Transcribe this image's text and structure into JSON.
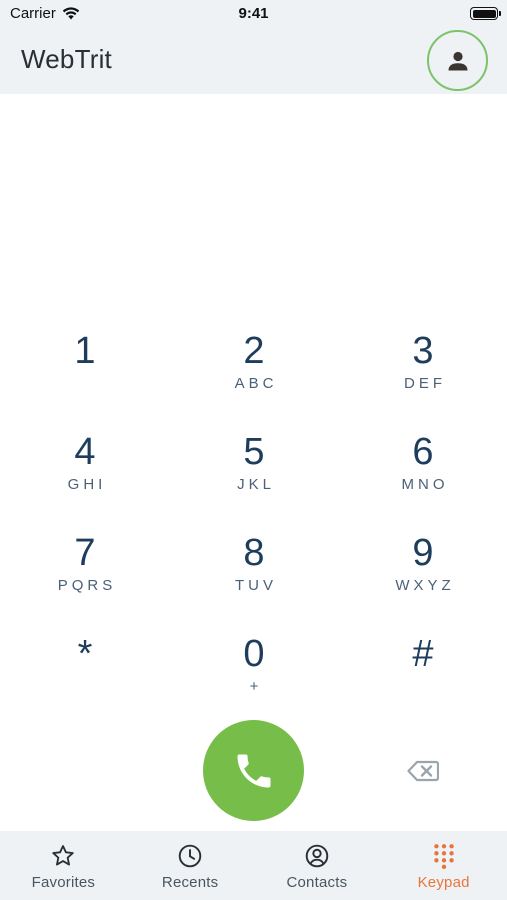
{
  "status_bar": {
    "carrier": "Carrier",
    "time": "9:41"
  },
  "header": {
    "title": "WebTrit"
  },
  "keypad": {
    "rows": [
      [
        {
          "digit": "1",
          "letters": ""
        },
        {
          "digit": "2",
          "letters": "ABC"
        },
        {
          "digit": "3",
          "letters": "DEF"
        }
      ],
      [
        {
          "digit": "4",
          "letters": "GHI"
        },
        {
          "digit": "5",
          "letters": "JKL"
        },
        {
          "digit": "6",
          "letters": "MNO"
        }
      ],
      [
        {
          "digit": "7",
          "letters": "PQRS"
        },
        {
          "digit": "8",
          "letters": "TUV"
        },
        {
          "digit": "9",
          "letters": "WXYZ"
        }
      ],
      [
        {
          "digit": "*",
          "letters": ""
        },
        {
          "digit": "0",
          "letters": "+"
        },
        {
          "digit": "#",
          "letters": ""
        }
      ]
    ]
  },
  "colors": {
    "accent_call": "#77bd4a",
    "active_tab": "#e8743b",
    "avatar_ring": "#7cc36a",
    "digit": "#1e3d5c"
  },
  "tabs": [
    {
      "label": "Favorites",
      "icon": "star-icon",
      "active": false
    },
    {
      "label": "Recents",
      "icon": "clock-icon",
      "active": false
    },
    {
      "label": "Contacts",
      "icon": "user-circle-icon",
      "active": false
    },
    {
      "label": "Keypad",
      "icon": "dialpad-icon",
      "active": true
    }
  ]
}
